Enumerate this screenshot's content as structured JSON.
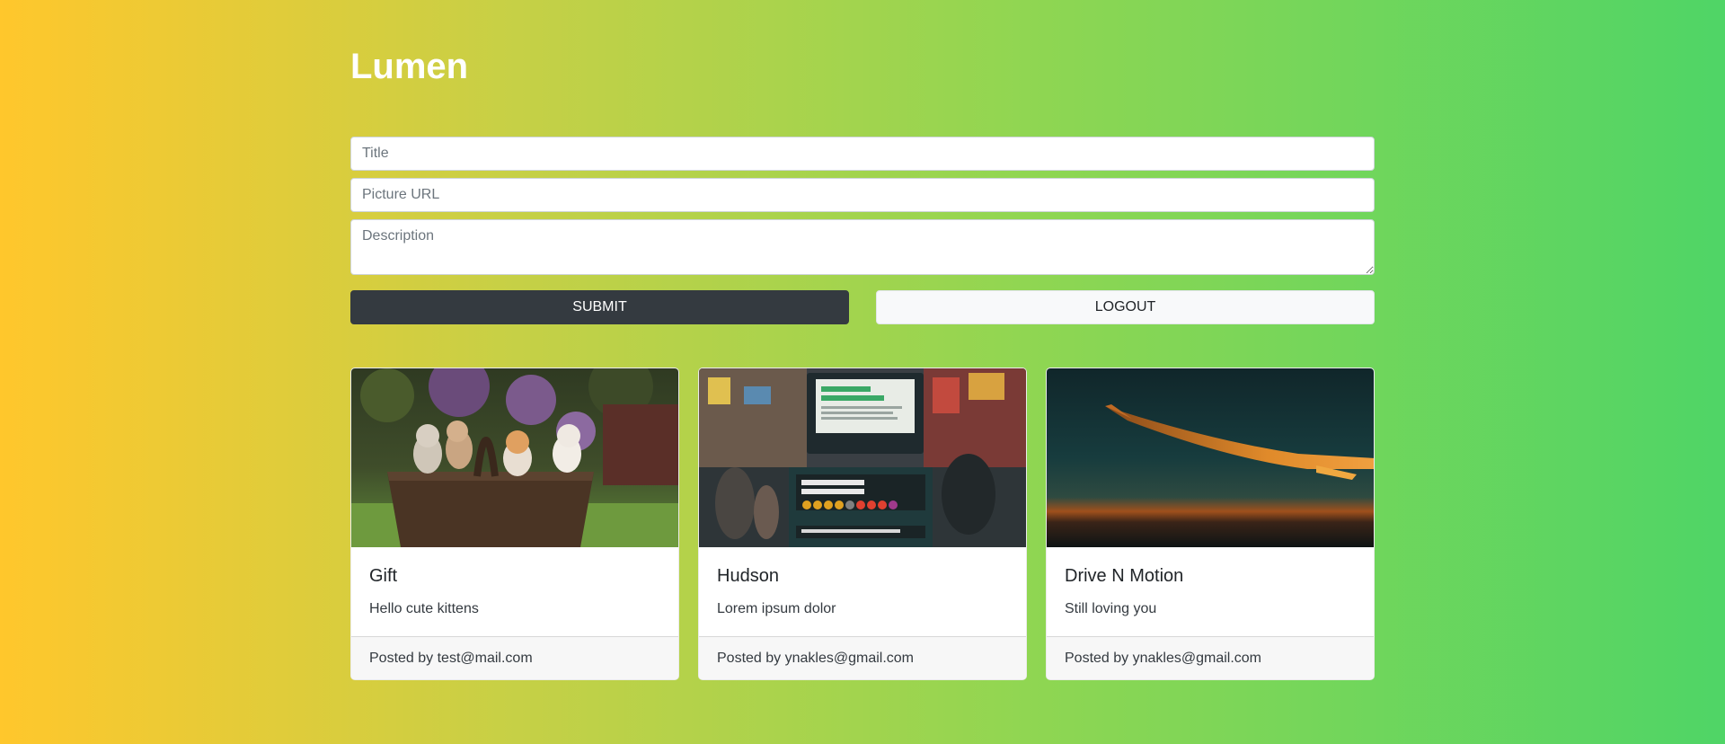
{
  "app": {
    "brand": "Lumen"
  },
  "form": {
    "title_placeholder": "Title",
    "url_placeholder": "Picture URL",
    "description_placeholder": "Description",
    "submit_label": "SUBMIT",
    "logout_label": "LOGOUT"
  },
  "posts": [
    {
      "title": "Gift",
      "description": "Hello cute kittens",
      "footer": "Posted by test@mail.com",
      "image": "kittens-in-basket"
    },
    {
      "title": "Hudson",
      "description": "Lorem ipsum dolor",
      "footer": "Posted by ynakles@gmail.com",
      "image": "times-square-subway"
    },
    {
      "title": "Drive N Motion",
      "description": "Still loving you",
      "footer": "Posted by ynakles@gmail.com",
      "image": "airplane-wing-sunset"
    }
  ],
  "colors": {
    "gradient_start": "#ffc72c",
    "gradient_end": "#4fd566",
    "submit_bg": "#343a40",
    "logout_bg": "#f8f9fa"
  }
}
